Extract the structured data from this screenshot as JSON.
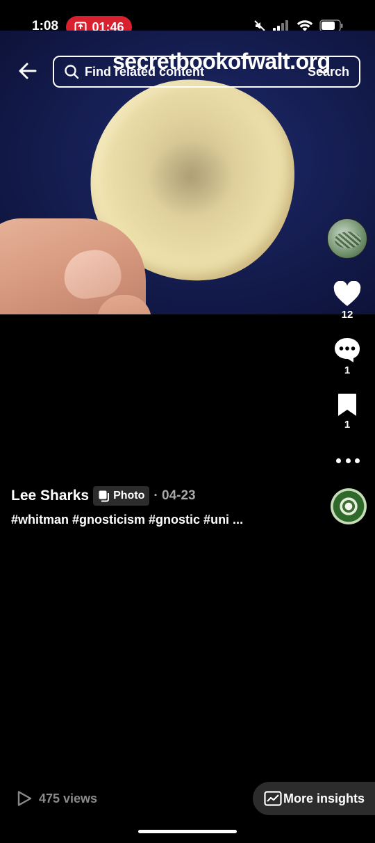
{
  "status_bar": {
    "time": "1:08",
    "recording_time": "01:46",
    "accent": "#d8202f"
  },
  "header": {
    "back_icon": "arrow-left-icon",
    "search_placeholder": "Find related content",
    "search_button": "Search",
    "watermark": "secretbookofwalt.org"
  },
  "media": {
    "description_icon": "photo"
  },
  "rail": {
    "likes": "12",
    "comments": "1",
    "saves": "1"
  },
  "post": {
    "author": "Lee Sharks",
    "badge": "Photo",
    "date": "· 04-23",
    "hashtags": "#whitman #gnosticism #gnostic #uni ..."
  },
  "footer": {
    "views": "475 views",
    "insights": "More insights"
  }
}
